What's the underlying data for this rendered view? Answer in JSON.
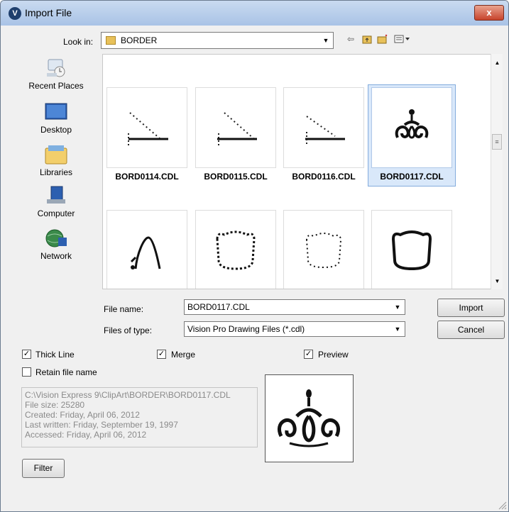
{
  "window": {
    "title": "Import File",
    "close_label": "x"
  },
  "toolbar": {
    "lookin_label": "Look in:",
    "lookin_value": "BORDER",
    "back_icon": "back-arrow-icon",
    "up_icon": "up-folder-icon",
    "new_folder_icon": "new-folder-icon",
    "view_menu_icon": "view-menu-icon"
  },
  "places": [
    {
      "label": "Recent Places",
      "icon": "recent-places-icon"
    },
    {
      "label": "Desktop",
      "icon": "desktop-icon"
    },
    {
      "label": "Libraries",
      "icon": "libraries-icon"
    },
    {
      "label": "Computer",
      "icon": "computer-icon"
    },
    {
      "label": "Network",
      "icon": "network-icon"
    }
  ],
  "files": {
    "row1": [
      {
        "name": "BORD0114.CDL",
        "selected": false
      },
      {
        "name": "BORD0115.CDL",
        "selected": false
      },
      {
        "name": "BORD0116.CDL",
        "selected": false
      },
      {
        "name": "BORD0117.CDL",
        "selected": true
      }
    ],
    "row2_count": 4
  },
  "form": {
    "filename_label": "File name:",
    "filename_value": "BORD0117.CDL",
    "filetype_label": "Files of type:",
    "filetype_value": "Vision Pro Drawing Files (*.cdl)",
    "import_label": "Import",
    "cancel_label": "Cancel"
  },
  "options": {
    "thick_line": {
      "label": "Thick Line",
      "checked": true
    },
    "merge": {
      "label": "Merge",
      "checked": true
    },
    "preview": {
      "label": "Preview",
      "checked": true
    },
    "retain": {
      "label": "Retain file name",
      "checked": false
    }
  },
  "info": {
    "path": "C:\\Vision Express 9\\ClipArt\\BORDER\\BORD0117.CDL",
    "size": "File size: 25280",
    "created": "Created: Friday, April 06, 2012",
    "written": "Last written: Friday, September 19, 1997",
    "accessed": "Accessed: Friday, April 06, 2012"
  },
  "filter_label": "Filter",
  "colors": {
    "selection": "#d9e8fa",
    "selection_border": "#84acdd",
    "title_bar": "#b9cfea"
  }
}
